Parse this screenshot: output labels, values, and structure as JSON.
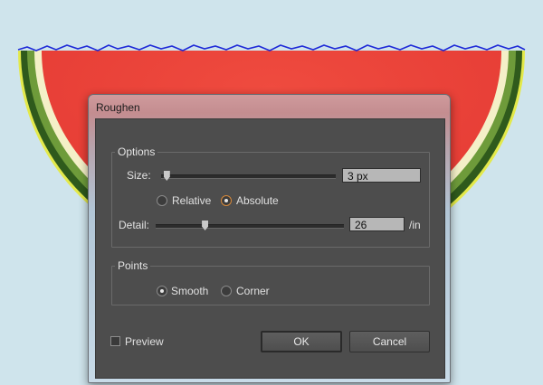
{
  "dialog": {
    "title": "Roughen",
    "options": {
      "legend": "Options",
      "size_label": "Size:",
      "size_value": "3 px",
      "size_level": 0.03,
      "relative_label": "Relative",
      "absolute_label": "Absolute",
      "selected_mode": "Absolute",
      "detail_label": "Detail:",
      "detail_value": "26",
      "detail_unit": "/in",
      "detail_level": 0.26
    },
    "points": {
      "legend": "Points",
      "smooth_label": "Smooth",
      "corner_label": "Corner",
      "selected": "Smooth"
    },
    "preview_label": "Preview",
    "preview_checked": false,
    "ok_label": "OK",
    "cancel_label": "Cancel"
  },
  "colors": {
    "background": "#cfe4ec",
    "flesh": "#e8443a",
    "rind_dark": "#2f5a1c",
    "rind_light": "#f4f0c8",
    "outline": "#1f2bd8",
    "highlight": "#e3e94a",
    "radio_selected": "#d8893a"
  }
}
